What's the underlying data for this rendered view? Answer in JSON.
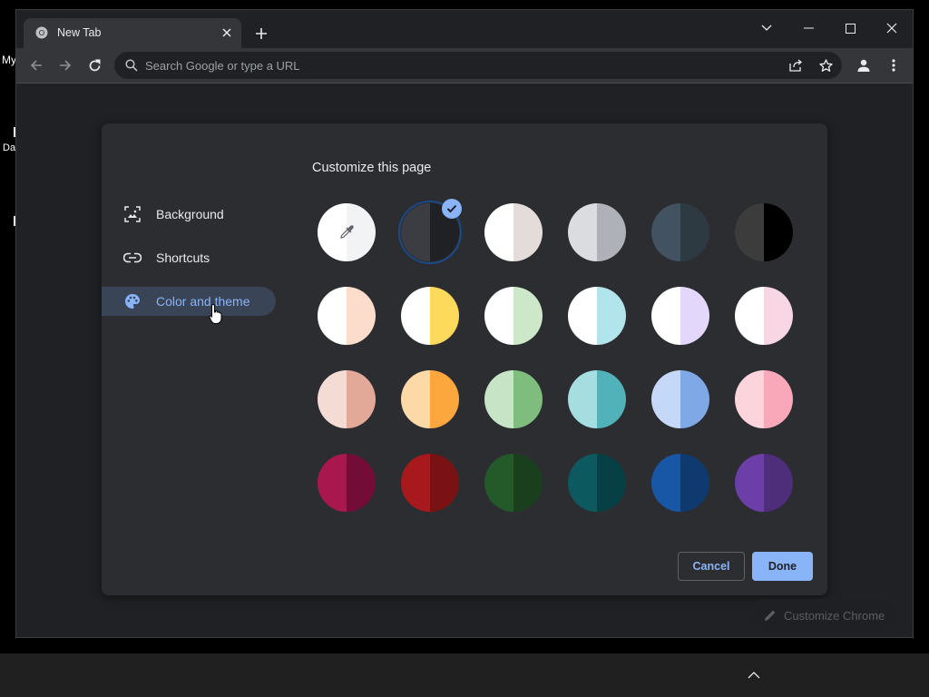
{
  "desktop": {
    "icon_label_1": "My",
    "icon_label_2": "Da"
  },
  "browser": {
    "tab": {
      "title": "New Tab",
      "favicon": "chrome-icon",
      "close_icon": "close-icon"
    },
    "new_tab_icon": "plus-icon",
    "window_controls": [
      "chevron-down-icon",
      "minimize-icon",
      "maximize-icon",
      "close-icon"
    ],
    "toolbar": {
      "back_icon": "arrow-left-icon",
      "forward_icon": "arrow-right-icon",
      "reload_icon": "reload-icon",
      "omnibox": {
        "placeholder": "Search Google or type a URL",
        "icon": "search-icon"
      },
      "share_icon": "share-icon",
      "bookmark_icon": "star-icon",
      "profile_icon": "person-icon",
      "menu_icon": "kebab-menu-icon"
    }
  },
  "dialog": {
    "title": "Customize this page",
    "menu": [
      {
        "label": "Background",
        "icon": "image-icon",
        "selected": false
      },
      {
        "label": "Shortcuts",
        "icon": "link-icon",
        "selected": false
      },
      {
        "label": "Color and theme",
        "icon": "palette-icon",
        "selected": true
      }
    ],
    "swatches": [
      {
        "left": "#ffffff",
        "right": "#f1f3f4",
        "custom_picker": true,
        "icon": "eyedropper-icon"
      },
      {
        "left": "#3c3d42",
        "right": "#202124",
        "selected": true
      },
      {
        "left": "#ffffff",
        "right": "#e4dcd8"
      },
      {
        "left": "#dadce0",
        "right": "#aeb1b8"
      },
      {
        "left": "#425260",
        "right": "#2e3a42"
      },
      {
        "left": "#3c3c3c",
        "right": "#000000"
      },
      {
        "left": "#ffffff",
        "right": "#fcdccb"
      },
      {
        "left": "#ffffff",
        "right": "#fdd95c"
      },
      {
        "left": "#ffffff",
        "right": "#cde8c8"
      },
      {
        "left": "#ffffff",
        "right": "#b2e4ec"
      },
      {
        "left": "#ffffff",
        "right": "#e4d7fc"
      },
      {
        "left": "#ffffff",
        "right": "#f8d6e4"
      },
      {
        "left": "#f4dcd4",
        "right": "#e2a898"
      },
      {
        "left": "#fdd9a8",
        "right": "#fba73e"
      },
      {
        "left": "#c8e4c6",
        "right": "#7ebd7e"
      },
      {
        "left": "#a6dde0",
        "right": "#52b2ba"
      },
      {
        "left": "#c6d8f8",
        "right": "#7ea8e6"
      },
      {
        "left": "#fcd4dc",
        "right": "#f8a8b8"
      },
      {
        "left": "#a8174e",
        "right": "#730d38"
      },
      {
        "left": "#a8191e",
        "right": "#7a1214"
      },
      {
        "left": "#24592a",
        "right": "#1a3f1d"
      },
      {
        "left": "#0c5a60",
        "right": "#063f44"
      },
      {
        "left": "#1856a6",
        "right": "#0f3a70"
      },
      {
        "left": "#6c3fa8",
        "right": "#4e2d7a"
      }
    ],
    "cancel_label": "Cancel",
    "done_label": "Done"
  },
  "customize_chrome": {
    "label": "Customize Chrome",
    "icon": "pencil-icon"
  },
  "taskbar": {
    "tray_icon": "chevron-up-icon"
  },
  "colors": {
    "accent": "#8ab4f8",
    "selected_menu_bg": "#394457",
    "dialog_bg": "#2c2d31",
    "page_bg": "#202124"
  }
}
